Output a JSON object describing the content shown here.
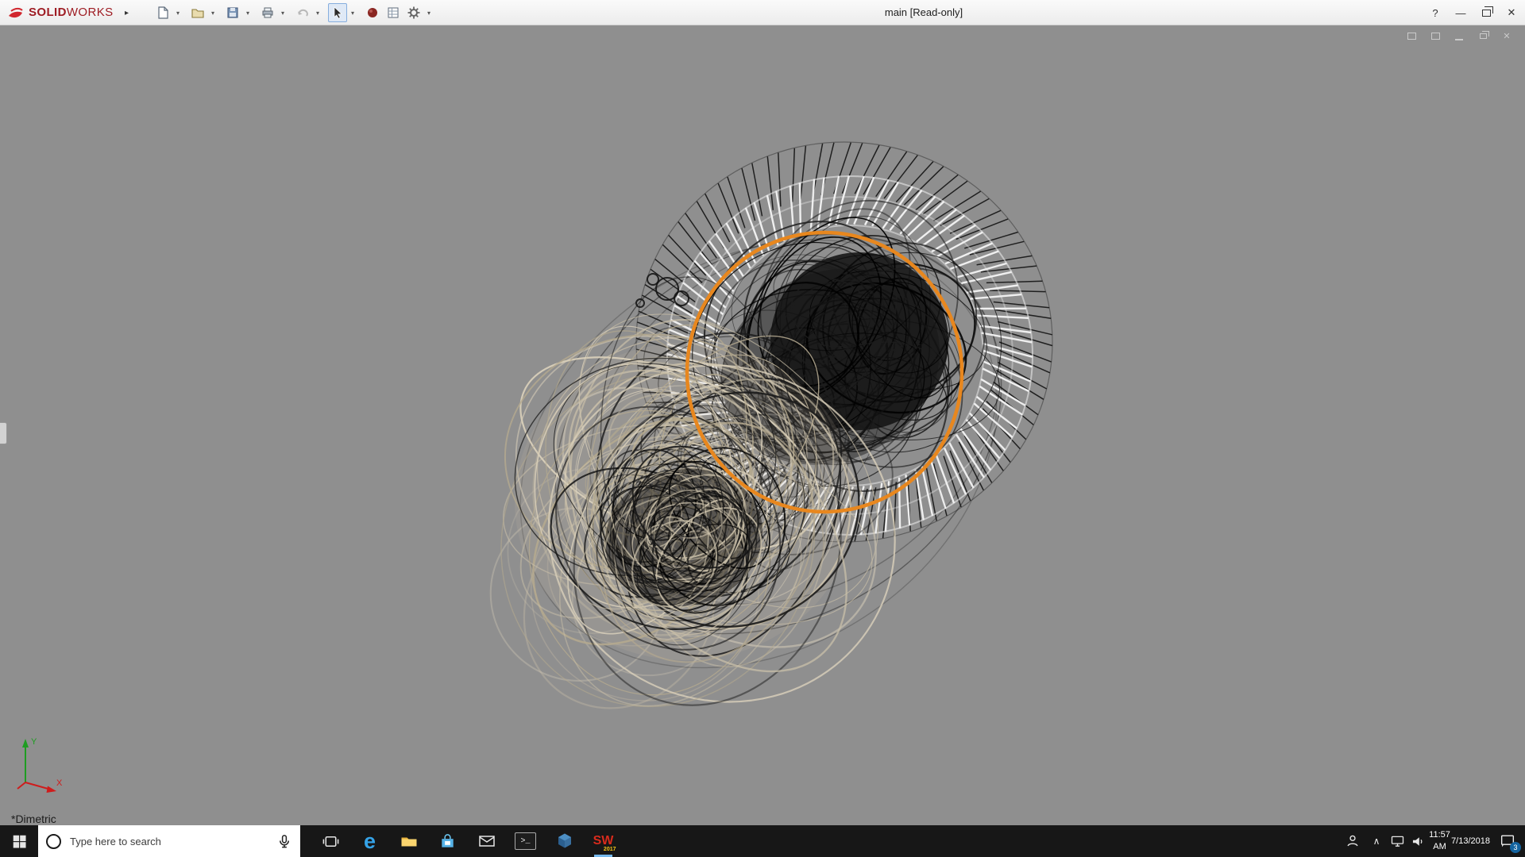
{
  "titlebar": {
    "logo_solid": "SOLID",
    "logo_works": "WORKS",
    "flyout_glyph": "▸",
    "caret_glyph": "▾",
    "title": "main [Read-only]",
    "help_glyph": "?",
    "min_glyph": "—",
    "close_glyph": "✕",
    "toolbar_icons": [
      "new-document",
      "open",
      "save",
      "print",
      "undo",
      "select-tool",
      "appearance-sphere",
      "design-table",
      "options-gear"
    ]
  },
  "viewport": {
    "view_orientation": "*Dimetric",
    "axis_x": "X",
    "axis_y": "Y",
    "document_controls": [
      "window",
      "restore-window",
      "minimize",
      "restore",
      "close"
    ]
  },
  "taskbar": {
    "search_placeholder": "Type here to search",
    "app_icons": [
      "task-view",
      "edge",
      "file-explorer",
      "store",
      "mail",
      "command-prompt",
      "3d-app",
      "solidworks-2017"
    ],
    "edge_letter": "e",
    "cmd_glyph": ">_",
    "sw_letters": "SW",
    "sw_year": "2017",
    "tray_chevron": "∧",
    "time": "11:57 AM",
    "date": "7/13/2018",
    "notification_count": "3"
  },
  "colors": {
    "selection_orange": "#e8871e",
    "wire_tan_light": "#d9cfba",
    "wire_tan": "#c9bfa8",
    "wire_tan_dark": "#b4a98f",
    "wire_black": "#111111",
    "wire_white": "#f5f5f5",
    "viewport_bg": "#8f8f8f",
    "taskbar_bg": "#171717",
    "logo_red": "#9e1c23"
  }
}
